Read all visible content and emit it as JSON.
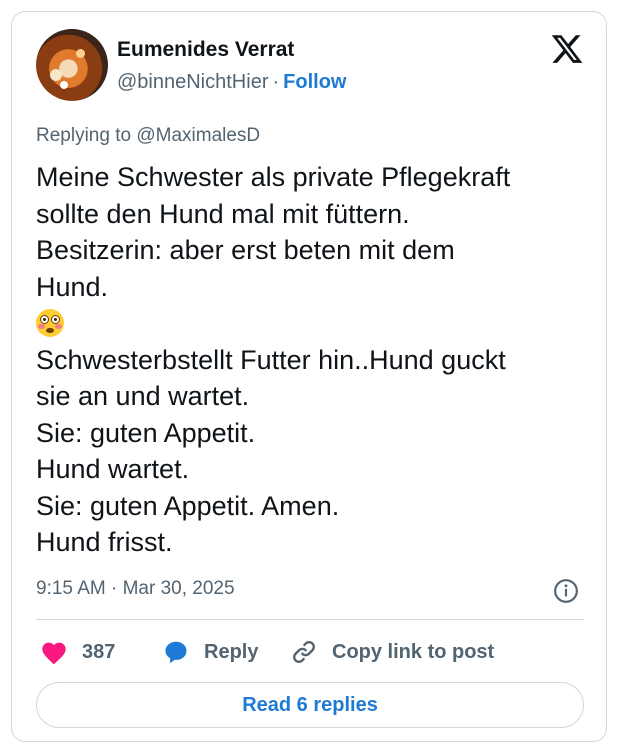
{
  "author": {
    "display_name": "Eumenides Verrat",
    "handle": "@binneNichtHier",
    "separator": "·",
    "follow_label": "Follow"
  },
  "brand": {
    "logo_icon": "x-logo-icon"
  },
  "replying_to": "Replying to @MaximalesD",
  "tweet": {
    "lines": [
      "Meine Schwester als private Pflegekraft",
      "sollte den Hund mal mit füttern.",
      "Besitzerin: aber erst beten mit dem",
      "Hund.",
      "",
      "Schwesterbstellt Futter hin..Hund guckt",
      "sie an und wartet.",
      "Sie: guten Appetit.",
      "Hund wartet.",
      "Sie: guten Appetit. Amen.",
      "Hund frisst."
    ],
    "emoji": "flushed-face"
  },
  "meta": {
    "time": "9:15 AM",
    "separator": "·",
    "date": "Mar 30, 2025",
    "info_icon": "info-icon"
  },
  "actions": {
    "like_count": "387",
    "reply_label": "Reply",
    "copy_label": "Copy link to post"
  },
  "footer": {
    "read_replies_label": "Read 6 replies"
  },
  "colors": {
    "accent": "#1d7bd6",
    "like": "#f91880",
    "secondary_text": "#536471",
    "border": "#cfd9de"
  }
}
